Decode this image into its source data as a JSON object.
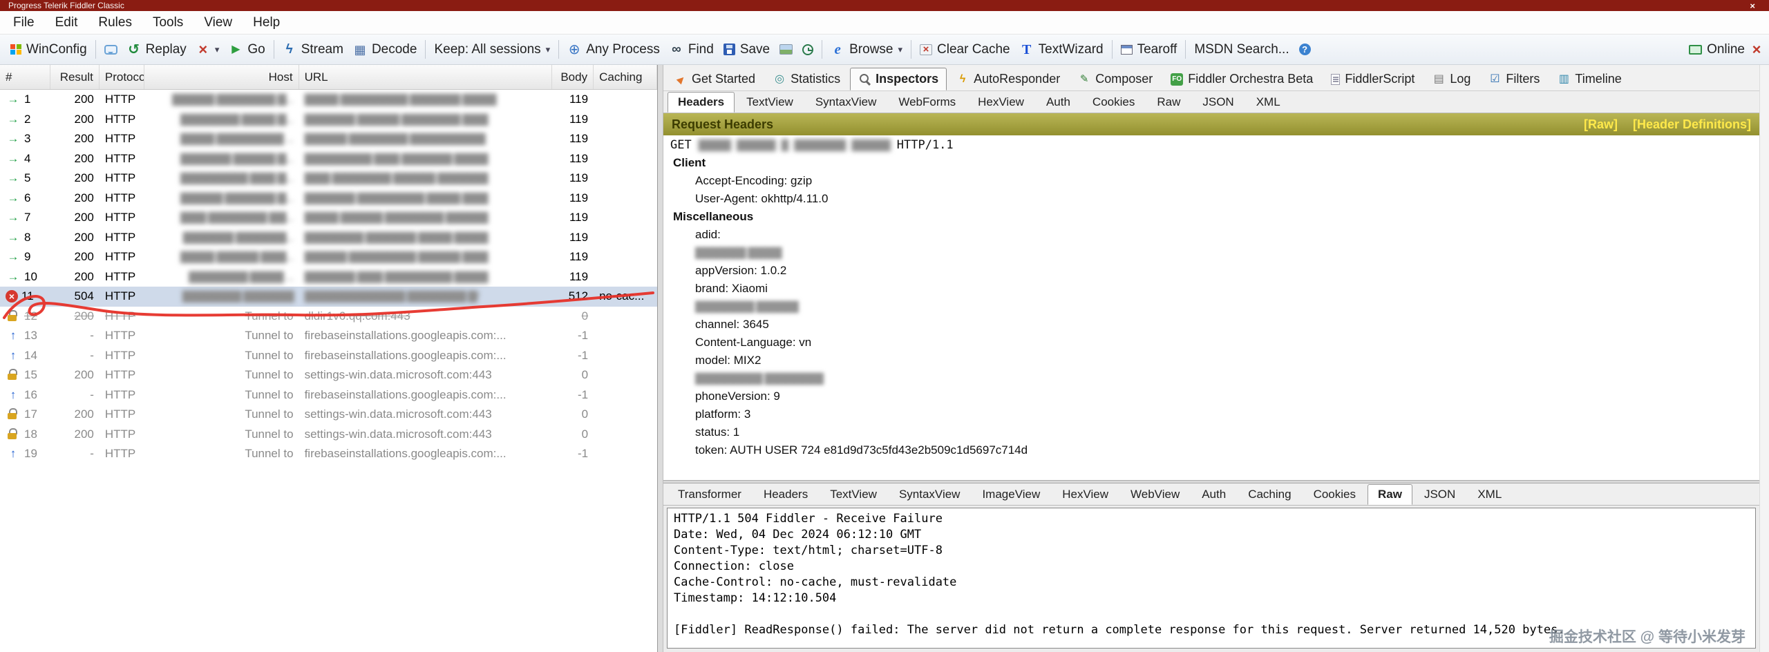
{
  "window": {
    "title": "Progress Telerik Fiddler Classic",
    "close_glyph": "×"
  },
  "menubar": {
    "items": [
      "File",
      "Edit",
      "Rules",
      "Tools",
      "View",
      "Help"
    ]
  },
  "toolbar": {
    "items": [
      {
        "icon": "winconfig",
        "label": "WinConfig"
      },
      {
        "kind": "sep"
      },
      {
        "icon": "comment",
        "label": ""
      },
      {
        "icon": "replay",
        "label": "Replay"
      },
      {
        "icon": "delete",
        "label": "",
        "dd": "dd"
      },
      {
        "icon": "go",
        "label": "Go"
      },
      {
        "kind": "sep"
      },
      {
        "icon": "stream",
        "label": "Stream"
      },
      {
        "icon": "decode",
        "label": "Decode"
      },
      {
        "kind": "sep"
      },
      {
        "label": "Keep: All sessions",
        "dd": "dd"
      },
      {
        "kind": "sep"
      },
      {
        "icon": "anyprocess",
        "label": "Any Process"
      },
      {
        "icon": "find",
        "label": "Find"
      },
      {
        "icon": "save",
        "label": "Save"
      },
      {
        "icon": "snapshot",
        "label": ""
      },
      {
        "icon": "clock",
        "label": ""
      },
      {
        "kind": "sep"
      },
      {
        "icon": "browse",
        "label": "Browse",
        "dd": "dd"
      },
      {
        "kind": "sep"
      },
      {
        "icon": "clearcache",
        "label": "Clear Cache"
      },
      {
        "icon": "textwizard",
        "label": "TextWizard"
      },
      {
        "kind": "sep"
      },
      {
        "icon": "tearoff",
        "label": "Tearoff"
      },
      {
        "kind": "sep"
      },
      {
        "label": "MSDN Search..."
      },
      {
        "icon": "help",
        "label": ""
      }
    ],
    "online_label": "Online"
  },
  "session_list": {
    "columns": [
      "#",
      "Result",
      "Protocol",
      "Host",
      "URL",
      "Body",
      "Caching"
    ],
    "rows": [
      {
        "icon": "ok",
        "num": "1",
        "result": "200",
        "protocol": "HTTP",
        "host": "▇▇▇▇▇ ▇▇▇▇▇▇▇ ▇...",
        "url": "▇▇▇▇ ▇▇▇▇▇▇▇▇ ▇▇▇▇▇▇ ▇▇▇▇",
        "body": "119",
        "caching": "",
        "state": "",
        "host_state": "redacted",
        "url_state": "redacted"
      },
      {
        "icon": "ok",
        "num": "2",
        "result": "200",
        "protocol": "HTTP",
        "host": "▇▇▇▇▇▇▇ ▇▇▇▇ ▇...",
        "url": "▇▇▇▇▇▇ ▇▇▇▇▇ ▇▇▇▇▇▇▇ ▇▇▇",
        "body": "119",
        "caching": "",
        "state": "",
        "host_state": "redacted",
        "url_state": "redacted"
      },
      {
        "icon": "ok",
        "num": "3",
        "result": "200",
        "protocol": "HTTP",
        "host": "▇▇▇▇ ▇▇▇▇▇▇▇▇ ...",
        "url": "▇▇▇▇▇ ▇▇▇▇▇▇▇ ▇▇▇▇▇▇▇▇▇",
        "body": "119",
        "caching": "",
        "state": "",
        "host_state": "redacted",
        "url_state": "redacted"
      },
      {
        "icon": "ok",
        "num": "4",
        "result": "200",
        "protocol": "HTTP",
        "host": "▇▇▇▇▇▇ ▇▇▇▇▇ ▇...",
        "url": "▇▇▇▇▇▇▇▇ ▇▇▇ ▇▇▇▇▇▇ ▇▇▇▇",
        "body": "119",
        "caching": "",
        "state": "",
        "host_state": "redacted",
        "url_state": "redacted"
      },
      {
        "icon": "ok",
        "num": "5",
        "result": "200",
        "protocol": "HTTP",
        "host": "▇▇▇▇▇▇▇▇ ▇▇▇ ▇...",
        "url": "▇▇▇ ▇▇▇▇▇▇▇ ▇▇▇▇▇ ▇▇▇▇▇▇",
        "body": "119",
        "caching": "",
        "state": "",
        "host_state": "redacted",
        "url_state": "redacted"
      },
      {
        "icon": "ok",
        "num": "6",
        "result": "200",
        "protocol": "HTTP",
        "host": "▇▇▇▇▇ ▇▇▇▇▇▇ ▇...",
        "url": "▇▇▇▇▇▇ ▇▇▇▇▇▇▇▇ ▇▇▇▇ ▇▇▇",
        "body": "119",
        "caching": "",
        "state": "",
        "host_state": "redacted",
        "url_state": "redacted"
      },
      {
        "icon": "ok",
        "num": "7",
        "result": "200",
        "protocol": "HTTP",
        "host": "▇▇▇ ▇▇▇▇▇▇▇ ▇▇...",
        "url": "▇▇▇▇ ▇▇▇▇▇ ▇▇▇▇▇▇▇ ▇▇▇▇▇",
        "body": "119",
        "caching": "",
        "state": "",
        "host_state": "redacted",
        "url_state": "redacted"
      },
      {
        "icon": "ok",
        "num": "8",
        "result": "200",
        "protocol": "HTTP",
        "host": "▇▇▇▇▇▇ ▇▇▇▇▇▇...",
        "url": "▇▇▇▇▇▇▇ ▇▇▇▇▇▇ ▇▇▇▇ ▇▇▇▇",
        "body": "119",
        "caching": "",
        "state": "",
        "host_state": "redacted",
        "url_state": "redacted"
      },
      {
        "icon": "ok",
        "num": "9",
        "result": "200",
        "protocol": "HTTP",
        "host": "▇▇▇▇ ▇▇▇▇▇ ▇▇▇...",
        "url": "▇▇▇▇▇ ▇▇▇▇▇▇▇▇ ▇▇▇▇▇ ▇▇▇",
        "body": "119",
        "caching": "",
        "state": "",
        "host_state": "redacted",
        "url_state": "redacted"
      },
      {
        "icon": "ok",
        "num": "10",
        "result": "200",
        "protocol": "HTTP",
        "host": "▇▇▇▇▇▇▇ ▇▇▇▇ ...",
        "url": "▇▇▇▇▇▇ ▇▇▇ ▇▇▇▇▇▇▇▇ ▇▇▇▇",
        "body": "119",
        "caching": "",
        "state": "",
        "host_state": "redacted",
        "url_state": "redacted"
      },
      {
        "icon": "error",
        "num": "11",
        "result": "504",
        "protocol": "HTTP",
        "host": "▇▇▇▇▇▇▇ ▇▇▇▇▇▇",
        "url": "▇▇▇▇▇▇▇▇▇▇▇▇ ▇▇▇▇▇▇▇ ▇/",
        "body": "512",
        "caching": "no-cac...",
        "state": "selected",
        "host_state": "redacted",
        "url_state": "redacted"
      },
      {
        "icon": "lock",
        "num": "12",
        "result": "200",
        "protocol": "HTTP",
        "host": "Tunnel to",
        "url": "dldir1v6.qq.com:443",
        "body": "0",
        "caching": "",
        "state": "aborted",
        "host_state": "",
        "url_state": ""
      },
      {
        "icon": "up",
        "num": "13",
        "result": "-",
        "protocol": "HTTP",
        "host": "Tunnel to",
        "url": "firebaseinstallations.googleapis.com:...",
        "body": "-1",
        "caching": "",
        "state": "tunnel",
        "host_state": "",
        "url_state": ""
      },
      {
        "icon": "up",
        "num": "14",
        "result": "-",
        "protocol": "HTTP",
        "host": "Tunnel to",
        "url": "firebaseinstallations.googleapis.com:...",
        "body": "-1",
        "caching": "",
        "state": "tunnel",
        "host_state": "",
        "url_state": ""
      },
      {
        "icon": "lock",
        "num": "15",
        "result": "200",
        "protocol": "HTTP",
        "host": "Tunnel to",
        "url": "settings-win.data.microsoft.com:443",
        "body": "0",
        "caching": "",
        "state": "tunnel",
        "host_state": "",
        "url_state": ""
      },
      {
        "icon": "up",
        "num": "16",
        "result": "-",
        "protocol": "HTTP",
        "host": "Tunnel to",
        "url": "firebaseinstallations.googleapis.com:...",
        "body": "-1",
        "caching": "",
        "state": "tunnel",
        "host_state": "",
        "url_state": ""
      },
      {
        "icon": "lock",
        "num": "17",
        "result": "200",
        "protocol": "HTTP",
        "host": "Tunnel to",
        "url": "settings-win.data.microsoft.com:443",
        "body": "0",
        "caching": "",
        "state": "tunnel",
        "host_state": "",
        "url_state": ""
      },
      {
        "icon": "lock",
        "num": "18",
        "result": "200",
        "protocol": "HTTP",
        "host": "Tunnel to",
        "url": "settings-win.data.microsoft.com:443",
        "body": "0",
        "caching": "",
        "state": "tunnel",
        "host_state": "",
        "url_state": ""
      },
      {
        "icon": "up",
        "num": "19",
        "result": "-",
        "protocol": "HTTP",
        "host": "Tunnel to",
        "url": "firebaseinstallations.googleapis.com:...",
        "body": "-1",
        "caching": "",
        "state": "tunnel",
        "host_state": "",
        "url_state": ""
      }
    ]
  },
  "main_tabs": {
    "items": [
      {
        "label": "Get Started",
        "icon": "rocket",
        "state": ""
      },
      {
        "label": "Statistics",
        "icon": "stats",
        "state": ""
      },
      {
        "label": "Inspectors",
        "icon": "inspectors",
        "state": "active"
      },
      {
        "label": "AutoResponder",
        "icon": "autoresponder",
        "state": ""
      },
      {
        "label": "Composer",
        "icon": "composer",
        "state": ""
      },
      {
        "label": "Fiddler Orchestra Beta",
        "icon": "orchestra",
        "state": ""
      },
      {
        "label": "FiddlerScript",
        "icon": "script",
        "state": ""
      },
      {
        "label": "Log",
        "icon": "log",
        "state": ""
      },
      {
        "label": "Filters",
        "icon": "filters",
        "state": ""
      },
      {
        "label": "Timeline",
        "icon": "timeline",
        "state": ""
      }
    ]
  },
  "request": {
    "tabs": [
      {
        "label": "Headers",
        "state": "active"
      },
      {
        "label": "TextView",
        "state": ""
      },
      {
        "label": "SyntaxView",
        "state": ""
      },
      {
        "label": "WebForms",
        "state": ""
      },
      {
        "label": "HexView",
        "state": ""
      },
      {
        "label": "Auth",
        "state": ""
      },
      {
        "label": "Cookies",
        "state": ""
      },
      {
        "label": "Raw",
        "state": ""
      },
      {
        "label": "JSON",
        "state": ""
      },
      {
        "label": "XML",
        "state": ""
      }
    ],
    "title": "Request Headers",
    "link_raw": "[Raw]",
    "link_header_definitions": "[Header Definitions]",
    "request_line": {
      "method": "GET",
      "url": "▇▇▇▇▇ ▇▇▇▇▇▇ ▇ ▇▇▇▇▇▇▇▇ ▇▇▇▇▇▇",
      "version": "HTTP/1.1"
    },
    "tree": [
      {
        "text": "Client",
        "kind": "group"
      },
      {
        "text": "Accept-Encoding: gzip",
        "kind": "item"
      },
      {
        "text": "User-Agent: okhttp/4.11.0",
        "kind": "item"
      },
      {
        "text": "Miscellaneous",
        "kind": "group"
      },
      {
        "text": "adid:",
        "kind": "item"
      },
      {
        "text": "▇▇▇▇▇▇ ▇▇▇▇",
        "kind": "item-redacted"
      },
      {
        "text": "appVersion: 1.0.2",
        "kind": "item"
      },
      {
        "text": "brand: Xiaomi",
        "kind": "item"
      },
      {
        "text": "▇▇▇▇▇▇▇ ▇▇▇▇▇",
        "kind": "item-redacted"
      },
      {
        "text": "channel: 3645",
        "kind": "item"
      },
      {
        "text": "Content-Language: vn",
        "kind": "item"
      },
      {
        "text": "model: MIX2",
        "kind": "item"
      },
      {
        "text": "▇▇▇▇▇▇▇▇ ▇▇▇▇▇▇▇",
        "kind": "item-redacted"
      },
      {
        "text": "phoneVersion: 9",
        "kind": "item"
      },
      {
        "text": "platform: 3",
        "kind": "item"
      },
      {
        "text": "status: 1",
        "kind": "item"
      },
      {
        "text": "token: AUTH USER 724 e81d9d73c5fd43e2b509c1d5697c714d",
        "kind": "item"
      }
    ]
  },
  "response": {
    "tabs": [
      {
        "label": "Transformer",
        "state": ""
      },
      {
        "label": "Headers",
        "state": ""
      },
      {
        "label": "TextView",
        "state": ""
      },
      {
        "label": "SyntaxView",
        "state": ""
      },
      {
        "label": "ImageView",
        "state": ""
      },
      {
        "label": "HexView",
        "state": ""
      },
      {
        "label": "WebView",
        "state": ""
      },
      {
        "label": "Auth",
        "state": ""
      },
      {
        "label": "Caching",
        "state": ""
      },
      {
        "label": "Cookies",
        "state": ""
      },
      {
        "label": "Raw",
        "state": "active"
      },
      {
        "label": "JSON",
        "state": ""
      },
      {
        "label": "XML",
        "state": ""
      }
    ],
    "raw_text": "HTTP/1.1 504 Fiddler - Receive Failure\nDate: Wed, 04 Dec 2024 06:12:10 GMT\nContent-Type: text/html; charset=UTF-8\nConnection: close\nCache-Control: no-cache, must-revalidate\nTimestamp: 14:12:10.504\n\n[Fiddler] ReadResponse() failed: The server did not return a complete response for this request. Server returned 14,520 bytes."
  },
  "watermark": "掘金技术社区 @ 等待小米发芽",
  "icons": {
    "session_ok": "green-arrow",
    "session_error": "red-circle-x",
    "session_lock": "https-lock",
    "session_up": "blue-up-arrow",
    "dropdown": "▾"
  },
  "colors": {
    "titlebar": "#8a1c12",
    "selection": "#cfdaea",
    "request_header_bar": "#a3a03a",
    "request_header_links": "#ffe94a",
    "error_red": "#d6392f",
    "online_green": "#2f8f46",
    "annotation_red": "#e63229"
  }
}
